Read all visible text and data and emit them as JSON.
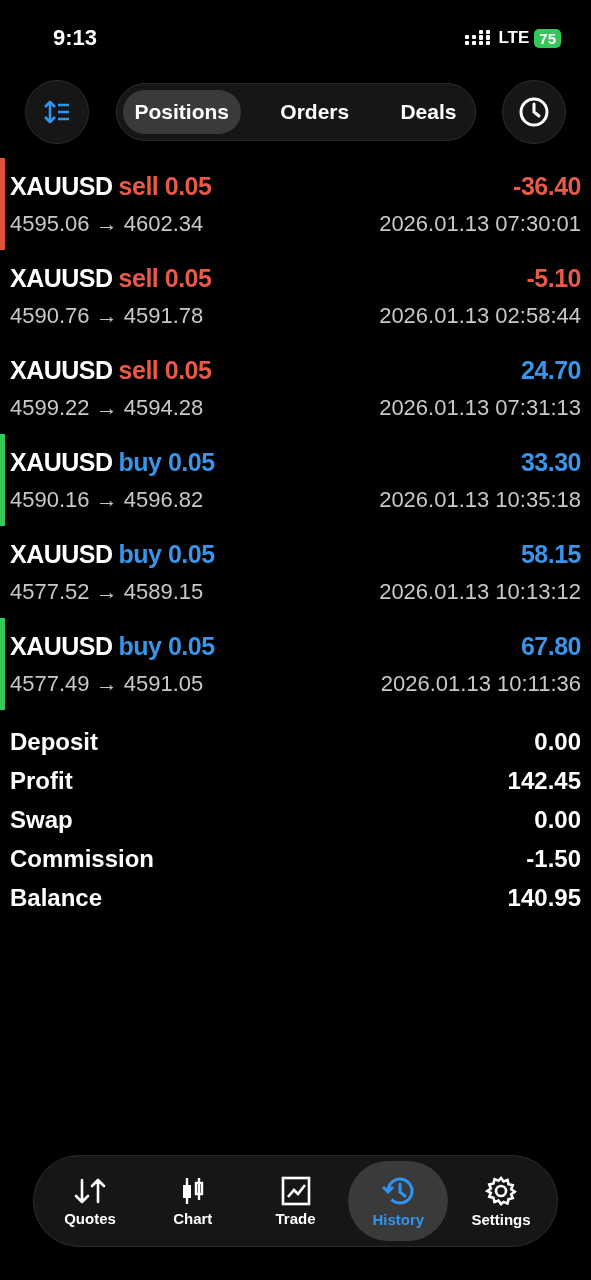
{
  "status_bar": {
    "time": "9:13",
    "network": "LTE",
    "battery": "75"
  },
  "tabs": [
    {
      "label": "Positions",
      "selected": true
    },
    {
      "label": "Orders",
      "selected": false
    },
    {
      "label": "Deals",
      "selected": false
    }
  ],
  "deals": [
    {
      "symbol": "XAUUSD",
      "side": "sell 0.05",
      "kind": "sell",
      "profit": "-36.40",
      "loss": true,
      "prices": "4595.06 → 4602.34",
      "time": "2026.01.13 07:30:01",
      "color": "#e0503c"
    },
    {
      "symbol": "XAUUSD",
      "side": "sell 0.05",
      "kind": "sell",
      "profit": "-5.10",
      "loss": true,
      "prices": "4590.76 → 4591.78",
      "time": "2026.01.13 02:58:44"
    },
    {
      "symbol": "XAUUSD",
      "side": "sell 0.05",
      "kind": "sell",
      "profit": "24.70",
      "loss": false,
      "prices": "4599.22 → 4594.28",
      "time": "2026.01.13 07:31:13"
    },
    {
      "symbol": "XAUUSD",
      "side": "buy 0.05",
      "kind": "buy",
      "profit": "33.30",
      "loss": false,
      "prices": "4590.16 → 4596.82",
      "time": "2026.01.13 10:35:18",
      "color": "#34c759"
    },
    {
      "symbol": "XAUUSD",
      "side": "buy 0.05",
      "kind": "buy",
      "profit": "58.15",
      "loss": false,
      "prices": "4577.52 → 4589.15",
      "time": "2026.01.13 10:13:12"
    },
    {
      "symbol": "XAUUSD",
      "side": "buy 0.05",
      "kind": "buy",
      "profit": "67.80",
      "loss": false,
      "prices": "4577.49 → 4591.05",
      "time": "2026.01.13 10:11:36",
      "color": "#34c759"
    }
  ],
  "summary": [
    {
      "label": "Deposit",
      "value": "0.00"
    },
    {
      "label": "Profit",
      "value": "142.45"
    },
    {
      "label": "Swap",
      "value": "0.00"
    },
    {
      "label": "Commission",
      "value": "-1.50"
    },
    {
      "label": "Balance",
      "value": "140.95"
    }
  ],
  "nav": [
    {
      "label": "Quotes",
      "kind": "quotes",
      "selected": false
    },
    {
      "label": "Chart",
      "kind": "chart",
      "selected": false
    },
    {
      "label": "Trade",
      "kind": "trade",
      "selected": false
    },
    {
      "label": "History",
      "kind": "history",
      "selected": true
    },
    {
      "label": "Settings",
      "kind": "settings",
      "selected": false
    }
  ]
}
